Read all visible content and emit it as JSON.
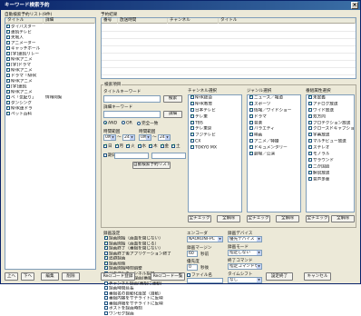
{
  "window": {
    "title": "キーワード検索予約"
  },
  "left": {
    "group_label": "自動検索予約リスト(9件)",
    "headers": [
      "タイトル",
      "詳細"
    ],
    "items": [
      {
        "title": "ダイバスター",
        "detail": ""
      },
      {
        "title": "連続テレビ",
        "detail": ""
      },
      {
        "title": "天地人",
        "detail": ""
      },
      {
        "title": "アニメーター",
        "detail": ""
      },
      {
        "title": "キャッチボール",
        "detail": ""
      },
      {
        "title": "[字]連続リレー",
        "detail": ""
      },
      {
        "title": "NHKアニメ",
        "detail": ""
      },
      {
        "title": "[字]ドラマ",
        "detail": ""
      },
      {
        "title": "NHKアニメ",
        "detail": ""
      },
      {
        "title": "ドラマ「NHK",
        "detail": ""
      },
      {
        "title": "NHKアニメ",
        "detail": ""
      },
      {
        "title": "[字]連続",
        "detail": ""
      },
      {
        "title": "NHKアニメ",
        "detail": ""
      },
      {
        "title": "ベ「気配り」",
        "detail": "情報閲覧"
      },
      {
        "title": "ダンシング",
        "detail": ""
      },
      {
        "title": "NHK連ドラ",
        "detail": ""
      },
      {
        "title": "ペット百科",
        "detail": ""
      }
    ],
    "buttons": [
      "上へ",
      "下へ",
      "編集",
      "削除"
    ]
  },
  "result": {
    "label": "予約結果",
    "headers": [
      "番号",
      "放送時間",
      "チャンネル",
      "タイトル"
    ]
  },
  "search": {
    "group_label": "検索項目",
    "title_keyword_label": "タイトルキーワード",
    "title_keyword_value": "",
    "detail_keyword_label": "詳細キーワード",
    "detail_keyword_value": "",
    "search_button": "検索",
    "clear_button": "詳細",
    "logic_options": [
      "AND",
      "OR",
      "完全一致"
    ],
    "logic_selected": 0,
    "time_label": "時間範囲",
    "time_from": "0時",
    "time_to": "24時",
    "dur_label": "時間範囲",
    "dur_from": "0時",
    "dur_to": "24時",
    "days": [
      "日",
      "月",
      "火",
      "水",
      "木",
      "金",
      "土"
    ],
    "date_label": "期日",
    "auto_button": "自動検索予約リスト追加"
  },
  "channels": {
    "label": "チャンネル選択",
    "items": [
      "NHK総合",
      "NHK教育",
      "日本テレビ",
      "テレ東",
      "TBS",
      "テレ東京",
      "フジテレビ",
      "CX",
      "TOKYO MX"
    ],
    "btn_all": "全チェック",
    "btn_none": "全解除"
  },
  "genre": {
    "label": "ジャンル選択",
    "items": [
      "ニュース／報道",
      "スポーツ",
      "情報／ワイドショー",
      "ドラマ",
      "音楽",
      "バラエティ",
      "映画",
      "アニメ／特撮",
      "ドキュメンタリー",
      "劇場／公演"
    ],
    "btn_all": "全チェック",
    "btn_none": "全解除"
  },
  "attr": {
    "label": "番組属性選択",
    "items": [
      "未定義",
      "アナログ放送",
      "ワイド放送",
      "双方向",
      "プロテクション放送",
      "クローズドキャプション",
      "字幕放送",
      "マルチビュー放送",
      "ステレオ",
      "モノラル",
      "サラウンド",
      "二か国語",
      "解説放送",
      "音声多重"
    ],
    "btn_all": "全チェック",
    "btn_none": "全解除"
  },
  "record": {
    "label": "録画設定",
    "options": [
      {
        "label": "録画開始（画面を閉じない）",
        "checked": true
      },
      {
        "label": "録画開始（画面を閉じる）",
        "checked": true
      },
      {
        "label": "録画終了（番組を閉じない）",
        "checked": true
      },
      {
        "label": "録画終了後アプリケーション終了",
        "checked": false
      },
      {
        "label": "追跡録画",
        "checked": true
      },
      {
        "label": "録画前後",
        "checked": true
      },
      {
        "label": "録画開始時刻調整",
        "checked": true
      },
      {
        "label": "リモコンチャンネル指定",
        "checked": false
      },
      {
        "label": "リモコン番組録画(番組に連動する)",
        "checked": false
      },
      {
        "label": "チャンネル録画(番組に連動)",
        "checked": false
      },
      {
        "label": "録画時間延長",
        "checked": false
      },
      {
        "label": "番組名の自動化設定（自動）",
        "checked": false
      },
      {
        "label": "番組内容をサテライトに反映",
        "checked": false
      },
      {
        "label": "番組詳細をサテライトに反映",
        "checked": false
      },
      {
        "label": "ポストを録画時刻",
        "checked": false
      },
      {
        "label": "ワンセグ録画",
        "checked": false
      }
    ]
  },
  "encoder": {
    "label": "エンコーダ",
    "value": "NAOKUNI-PC",
    "margin_label": "録画マージン",
    "margin_value": "60",
    "margin_unit": "秒前",
    "priority_label": "優先度",
    "priority_value": "0",
    "priority_unit": "秒後",
    "file_label": "ファイル名",
    "file_value": ""
  },
  "device": {
    "label": "録画デバイス",
    "value": "優先デバイス",
    "mode_label": "録画モード",
    "mode_value": "指定しない",
    "start_label": "開始",
    "start_value": "指定しない",
    "end_label": "終了コマンド",
    "end_value": "指定コマンドなし",
    "user_label": "タイムシフト",
    "user_value": "なし",
    "duplicate_label": "タイトル重複時",
    "duplicate_checked": false
  },
  "footer": {
    "btn_rec": "Rec/コード登録",
    "btn_edit": "Rec/コード一覧",
    "btn_ok": "設定終了",
    "btn_cancel": "キャンセル"
  }
}
